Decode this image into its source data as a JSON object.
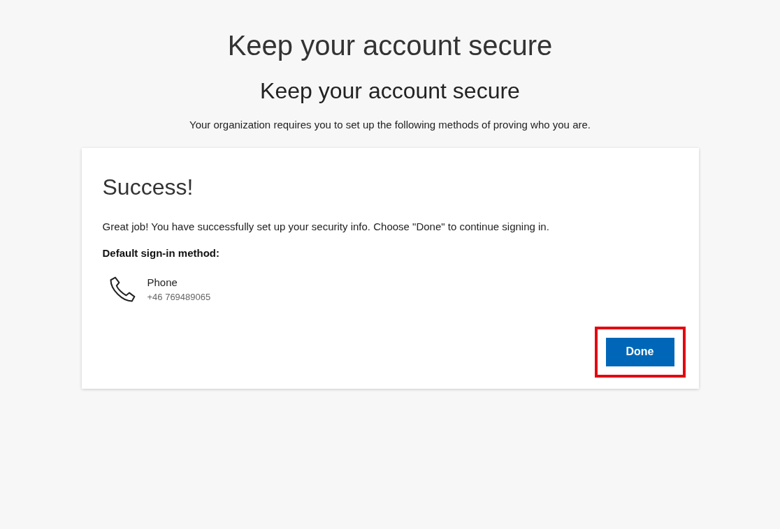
{
  "header": {
    "title": "Keep your account secure"
  },
  "page": {
    "title": "Keep your account secure",
    "subtitle": "Your organization requires you to set up the following methods of proving who you are."
  },
  "card": {
    "title": "Success!",
    "message": "Great job! You have successfully set up your security info. Choose \"Done\" to continue signing in.",
    "default_label": "Default sign-in method:",
    "method": {
      "kind": "phone",
      "name": "Phone",
      "value": "+46 769489065"
    },
    "button": {
      "label": "Done",
      "highlighted": true
    }
  }
}
